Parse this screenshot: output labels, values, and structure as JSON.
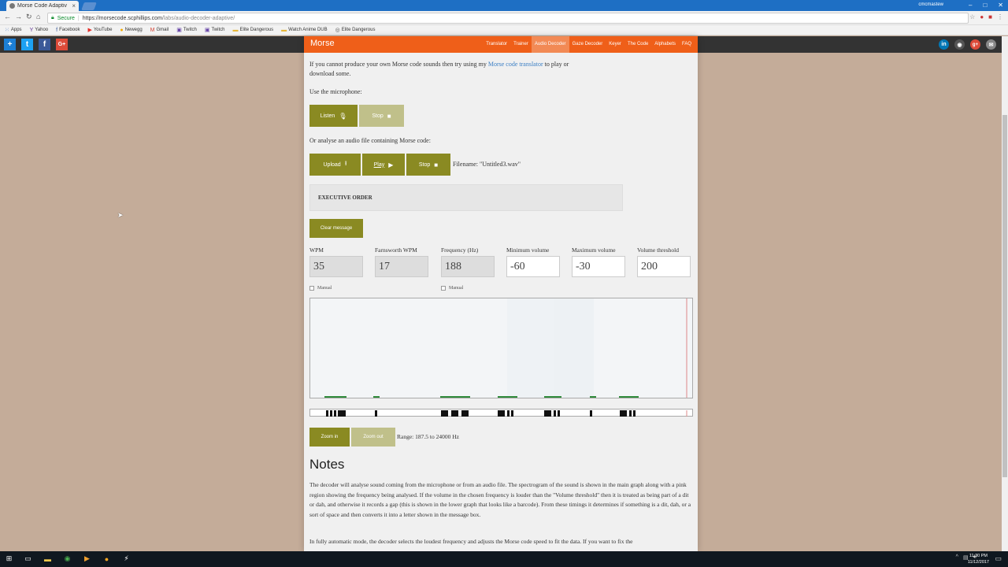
{
  "browser": {
    "tab_title": "Morse Code Adaptiv",
    "tab_close": "×",
    "user": "cmcmastew",
    "window_controls": [
      "–",
      "□",
      "✕"
    ],
    "url_secure": "Secure",
    "url_host": "https://morsecode.scphillips.com",
    "url_path": "/labs/audio-decoder-adaptive/",
    "bookmarks": [
      {
        "label": "Apps",
        "icon": "apps-icon",
        "glyph": "⁙",
        "color": "#4a79c6"
      },
      {
        "label": "Yahoo",
        "icon": "yahoo-icon",
        "glyph": "Y",
        "color": "#5b2d90"
      },
      {
        "label": "Facebook",
        "icon": "facebook-icon",
        "glyph": "f",
        "color": "#3b5998"
      },
      {
        "label": "YouTube",
        "icon": "youtube-icon",
        "glyph": "▶",
        "color": "#e52d27"
      },
      {
        "label": "Newegg",
        "icon": "newegg-icon",
        "glyph": "●",
        "color": "#f2a900"
      },
      {
        "label": "Gmail",
        "icon": "gmail-icon",
        "glyph": "M",
        "color": "#d44638"
      },
      {
        "label": "Twitch",
        "icon": "twitch-icon",
        "glyph": "▣",
        "color": "#6441a5"
      },
      {
        "label": "Twitch",
        "icon": "twitch-icon",
        "glyph": "▣",
        "color": "#6441a5"
      },
      {
        "label": "Elite Dangerous",
        "icon": "folder-icon",
        "glyph": "▬",
        "color": "#e8b83a"
      },
      {
        "label": "Watch Anime DUB",
        "icon": "folder-icon",
        "glyph": "▬",
        "color": "#e8b83a"
      },
      {
        "label": "Elite Dangerous",
        "icon": "elite-dangerous-icon",
        "glyph": "◎",
        "color": "#555555"
      }
    ]
  },
  "site": {
    "brand": "Morse",
    "nav": [
      {
        "label": "Translator",
        "active": false
      },
      {
        "label": "Trainer",
        "active": false
      },
      {
        "label": "Audio Decoder",
        "active": true
      },
      {
        "label": "Gaze Decoder",
        "active": false
      },
      {
        "label": "Keyer",
        "active": false
      },
      {
        "label": "The Code",
        "active": false
      },
      {
        "label": "Alphabets",
        "active": false
      },
      {
        "label": "FAQ",
        "active": false
      }
    ]
  },
  "intro": {
    "text_before": "If you cannot produce your own Morse code sounds then try using my ",
    "link": "Morse code translator",
    "text_after": " to play or",
    "line2": "download some."
  },
  "mic": {
    "label": "Use the microphone:",
    "listen": "Listen",
    "stop": "Stop"
  },
  "file": {
    "label": "Or analyse an audio file containing Morse code:",
    "upload": "Upload",
    "play": "Play",
    "stop": "Stop",
    "filename": "Filename: \"Untitled3.wav\""
  },
  "message": "EXECUTIVE ORDER",
  "clear_message": "Clear message",
  "fields": [
    {
      "label": "WPM",
      "value": "35",
      "readonly": true
    },
    {
      "label": "Farnsworth WPM",
      "value": "17",
      "readonly": true
    },
    {
      "label": "Frequency (Hz)",
      "value": "188",
      "readonly": true
    },
    {
      "label": "Minimum volume",
      "value": "-60",
      "readonly": false
    },
    {
      "label": "Maximum volume",
      "value": "-30",
      "readonly": false
    },
    {
      "label": "Volume threshold",
      "value": "200",
      "readonly": false
    }
  ],
  "manual_label": "Manual",
  "zoom": {
    "zoom_in": "Zoom in",
    "zoom_out": "Zoom out",
    "range": "Range: 187.5 to 24000 Hz"
  },
  "notes": {
    "heading": "Notes",
    "p1": "The decoder will analyse sound coming from the microphone or from an audio file. The spectrogram of the sound is shown in the main graph along with a pink region showing the frequency being analysed. If the volume in the chosen frequency is louder than the \"Volume threshold\" then it is treated as being part of a dit or dah, and otherwise it records a gap (this is shown in the lower graph that looks like a barcode). From these timings it determines if something is a dit, dah, or a sort of space and then converts it into a letter shown in the message box.",
    "p2": "In fully automatic mode, the decoder selects the loudest frequency and adjusts the Morse code speed to fit the data. If you want to fix the"
  },
  "taskbar": {
    "time": "11:30 PM",
    "date": "11/12/2017"
  },
  "colors": {
    "accent_orange": "#ef5f19",
    "button_olive": "#8a8a22",
    "link_blue": "#3a7ec4"
  }
}
